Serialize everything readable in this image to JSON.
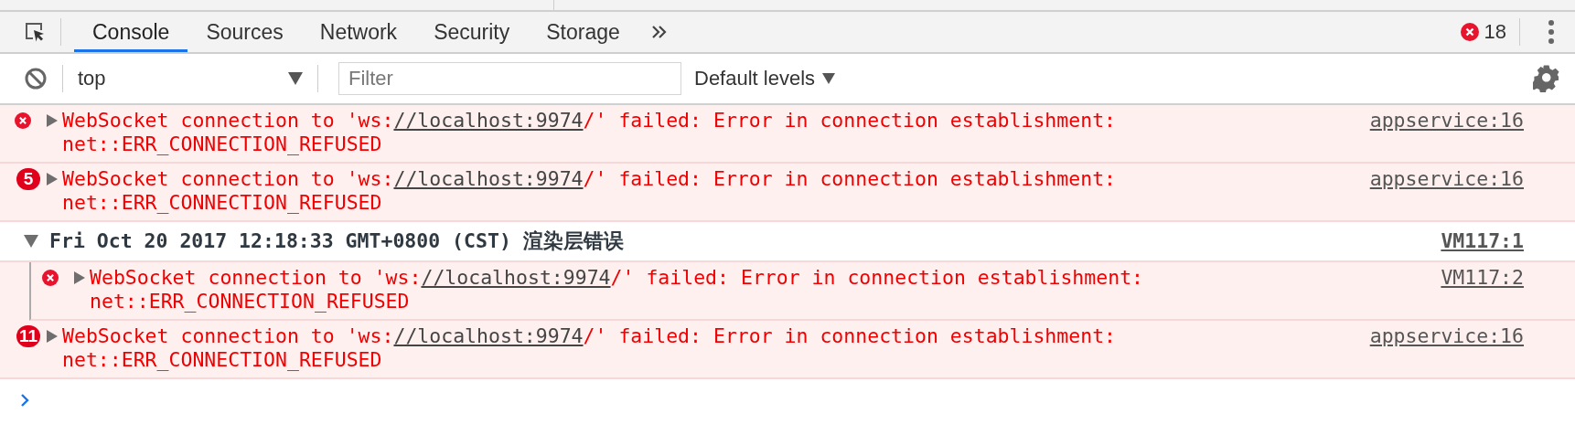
{
  "tabs": [
    {
      "label": "Console",
      "selected": true
    },
    {
      "label": "Sources",
      "selected": false
    },
    {
      "label": "Network",
      "selected": false
    },
    {
      "label": "Security",
      "selected": false
    },
    {
      "label": "Storage",
      "selected": false
    }
  ],
  "error_count": "18",
  "toolbar": {
    "context": "top",
    "filter": {
      "placeholder": "Filter"
    },
    "levels": "Default levels"
  },
  "messages": [
    {
      "kind": "error",
      "expanded": false,
      "text": "WebSocket connection to 'ws:",
      "url": "//localhost:9974",
      "rest": "/' failed: Error in connection establishment:",
      "line2": "net::ERR_CONNECTION_REFUSED",
      "source": "appservice:16"
    },
    {
      "kind": "error",
      "repeat": "5",
      "expanded": false,
      "text": "WebSocket connection to 'ws:",
      "url": "//localhost:9974",
      "rest": "/' failed: Error in connection establishment:",
      "line2": "net::ERR_CONNECTION_REFUSED",
      "source": "appservice:16"
    },
    {
      "kind": "group",
      "expanded": true,
      "title": "Fri Oct 20 2017 12:18:33 GMT+0800 (CST) 渲染层错误",
      "source": "VM117:1",
      "children": [
        {
          "kind": "error",
          "expanded": false,
          "text": "WebSocket connection to 'ws:",
          "url": "//localhost:9974",
          "rest": "/' failed: Error in connection establishment:",
          "line2": "net::ERR_CONNECTION_REFUSED",
          "source": "VM117:2"
        }
      ]
    },
    {
      "kind": "error",
      "repeat": "11",
      "expanded": false,
      "text": "WebSocket connection to 'ws:",
      "url": "//localhost:9974",
      "rest": "/' failed: Error in connection establishment:",
      "line2": "net::ERR_CONNECTION_REFUSED",
      "source": "appservice:16"
    }
  ]
}
